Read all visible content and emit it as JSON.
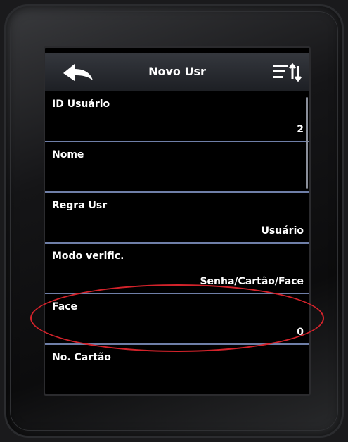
{
  "header": {
    "title": "Novo Usr",
    "back_icon": "back-arrow-icon",
    "sort_icon": "sort-menu-icon"
  },
  "fields": [
    {
      "label": "ID Usuário",
      "value": "2"
    },
    {
      "label": "Nome",
      "value": ""
    },
    {
      "label": "Regra Usr",
      "value": "Usuário"
    },
    {
      "label": "Modo verific.",
      "value": "Senha/Cartão/Face"
    },
    {
      "label": "Face",
      "value": "0"
    },
    {
      "label": "No. Cartão",
      "value": ""
    }
  ],
  "colors": {
    "divider": "#6f7fa8",
    "highlight": "#d4232b"
  }
}
